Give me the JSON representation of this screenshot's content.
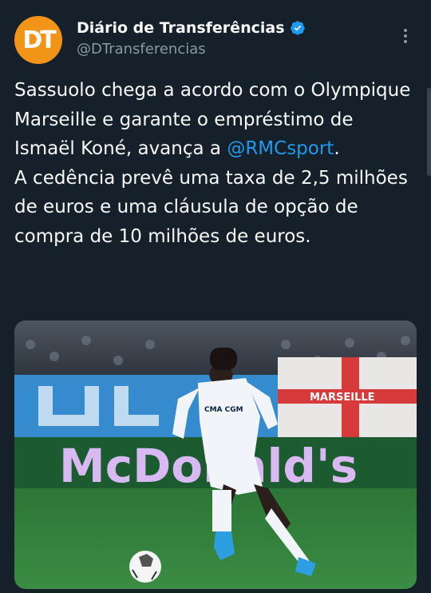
{
  "author": {
    "avatar_text": "DT",
    "display_name": "Diário de Transferências",
    "handle": "@DTransferencias",
    "verified": true
  },
  "tweet": {
    "line1_before": "Sassuolo chega a acordo com o Olympique Marseille e garante o empréstimo de Ismaël Koné, avança a ",
    "mention": "@RMCsport",
    "line1_after": ".",
    "line2": "A cedência prevê uma taxa de 2,5 milhões de euros e uma cláusula de opção de compra de 10 milhões de euros."
  },
  "media": {
    "ad_board_text": "McDonald's",
    "shirt_sponsor": "CMA CGM",
    "stand_banner_text": "MARSEILLE"
  },
  "colors": {
    "background": "#15202b",
    "accent": "#1d9bf0",
    "secondary_text": "#8b98a5",
    "avatar": "#f29418",
    "pitch": "#2f7d3a"
  },
  "icons": {
    "verified": "verified-badge-icon",
    "more": "more-options-icon"
  }
}
